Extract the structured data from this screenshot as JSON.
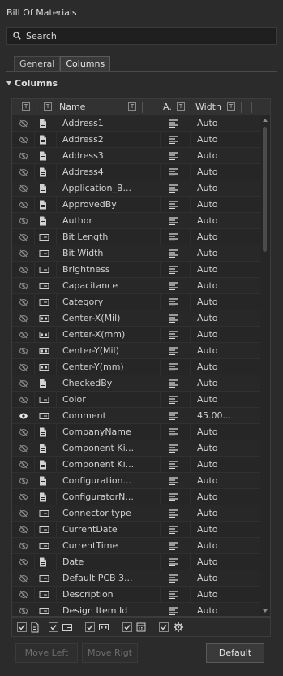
{
  "panel": {
    "title": "Bill Of Materials"
  },
  "search": {
    "placeholder": "Search"
  },
  "tabs": [
    {
      "label": "General"
    },
    {
      "label": "Columns"
    }
  ],
  "section": {
    "title": "Columns"
  },
  "table": {
    "headers": {
      "name": "Name",
      "align": "A.",
      "width": "Width",
      "t": "T"
    },
    "rows": [
      {
        "name": "Address1",
        "width": "Auto",
        "visible": false,
        "type": "param"
      },
      {
        "name": "Address2",
        "width": "Auto",
        "visible": false,
        "type": "param"
      },
      {
        "name": "Address3",
        "width": "Auto",
        "visible": false,
        "type": "param"
      },
      {
        "name": "Address4",
        "width": "Auto",
        "visible": false,
        "type": "param"
      },
      {
        "name": "Application_B...",
        "width": "Auto",
        "visible": false,
        "type": "param"
      },
      {
        "name": "ApprovedBy",
        "width": "Auto",
        "visible": false,
        "type": "param"
      },
      {
        "name": "Author",
        "width": "Auto",
        "visible": false,
        "type": "param"
      },
      {
        "name": "Bit Length",
        "width": "Auto",
        "visible": false,
        "type": "property"
      },
      {
        "name": "Bit Width",
        "width": "Auto",
        "visible": false,
        "type": "property"
      },
      {
        "name": "Brightness",
        "width": "Auto",
        "visible": false,
        "type": "property"
      },
      {
        "name": "Capacitance",
        "width": "Auto",
        "visible": false,
        "type": "property"
      },
      {
        "name": "Category",
        "width": "Auto",
        "visible": false,
        "type": "property"
      },
      {
        "name": "Center-X(Mil)",
        "width": "Auto",
        "visible": false,
        "type": "pcb"
      },
      {
        "name": "Center-X(mm)",
        "width": "Auto",
        "visible": false,
        "type": "pcb"
      },
      {
        "name": "Center-Y(Mil)",
        "width": "Auto",
        "visible": false,
        "type": "pcb"
      },
      {
        "name": "Center-Y(mm)",
        "width": "Auto",
        "visible": false,
        "type": "pcb"
      },
      {
        "name": "CheckedBy",
        "width": "Auto",
        "visible": false,
        "type": "param"
      },
      {
        "name": "Color",
        "width": "Auto",
        "visible": false,
        "type": "property"
      },
      {
        "name": "Comment",
        "width": "45.00...",
        "visible": true,
        "type": "property"
      },
      {
        "name": "CompanyName",
        "width": "Auto",
        "visible": false,
        "type": "param"
      },
      {
        "name": "Component Ki...",
        "width": "Auto",
        "visible": false,
        "type": "param"
      },
      {
        "name": "Component Ki...",
        "width": "Auto",
        "visible": false,
        "type": "param"
      },
      {
        "name": "Configuration...",
        "width": "Auto",
        "visible": false,
        "type": "param"
      },
      {
        "name": "ConfiguratorN...",
        "width": "Auto",
        "visible": false,
        "type": "param"
      },
      {
        "name": "Connector type",
        "width": "Auto",
        "visible": false,
        "type": "property"
      },
      {
        "name": "CurrentDate",
        "width": "Auto",
        "visible": false,
        "type": "property"
      },
      {
        "name": "CurrentTime",
        "width": "Auto",
        "visible": false,
        "type": "property"
      },
      {
        "name": "Date",
        "width": "Auto",
        "visible": false,
        "type": "param"
      },
      {
        "name": "Default PCB 3...",
        "width": "Auto",
        "visible": false,
        "type": "property"
      },
      {
        "name": "Description",
        "width": "Auto",
        "visible": false,
        "type": "property"
      },
      {
        "name": "Design Item Id",
        "width": "Auto",
        "visible": false,
        "type": "property"
      }
    ]
  },
  "buttons": {
    "move_left": "Move Left",
    "move_right": "Move Rigt",
    "default": "Default"
  },
  "colors": {
    "bg": "#2b2b2b",
    "grid_bg": "#262626",
    "text": "#d4d4d4"
  }
}
